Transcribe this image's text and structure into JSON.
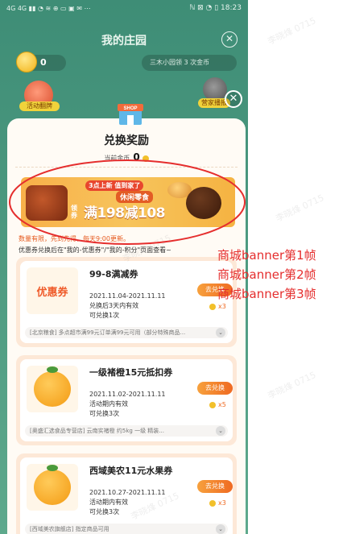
{
  "status_bar": {
    "left": "4G 4G ▮▮ ◔ ≋ ⊕ ▭ ▣ ✉ ⋯",
    "right": "ℕ ⊠ ◔ ▯ 18:23"
  },
  "farm": {
    "title": "我的庄园",
    "close": "✕",
    "coin_count": "0",
    "tip": "三木小园领 3 次金币",
    "activity_label": "活动翻牌",
    "broadcast_label": "营家播报"
  },
  "modal": {
    "close": "✕",
    "title": "兑换奖励",
    "gold_label": "当前金币",
    "gold_value": "0"
  },
  "banner": {
    "tag": "3点上新",
    "tag2": "值到家了",
    "sub": "休闲零食",
    "label": "领券",
    "main": "满198减108"
  },
  "notes": {
    "update": "数量有限，先到先得，每天9:00更新。",
    "rules": "优惠券兑换后在\"我的-优惠券\"/\"我的-积分\"页面查看~"
  },
  "cards": [
    {
      "thumb_text": "优惠券",
      "name": "99-8满减券",
      "date": "2021.11.04-2021.11.11",
      "validity": "兑换后3天内有效",
      "limit": "可兑换1次",
      "button": "去兑换",
      "cost": "x3",
      "footer": "[北京粮食] 多点超市满99元订单满99元可用（部分特殊商品...",
      "chev": "⌄"
    },
    {
      "thumb_text": "",
      "name": "一级褚橙15元抵扣券",
      "date": "2021.11.02-2021.11.11",
      "validity": "活动期内有效",
      "limit": "可兑换3次",
      "button": "去兑换",
      "cost": "x5",
      "footer": "[奥盛汇选食品专营店] 云南实褚橙 约5kg 一级 精装...",
      "chev": "⌄"
    },
    {
      "thumb_text": "",
      "name": "西域美农11元水果券",
      "date": "2021.10.27-2021.11.11",
      "validity": "活动期内有效",
      "limit": "可兑换3次",
      "button": "去兑换",
      "cost": "x3",
      "footer": "[西域美农旗舰店] 指定商品可用",
      "chev": "⌄"
    }
  ],
  "annotations": [
    "商城banner第1帧",
    "商城banner第2帧",
    "商城banner第3帧"
  ],
  "watermark": "李晓烽 0715",
  "colors": {
    "accent": "#ef6a22",
    "annotation": "#e52e2e",
    "farm_bg": "#3e8d76"
  }
}
